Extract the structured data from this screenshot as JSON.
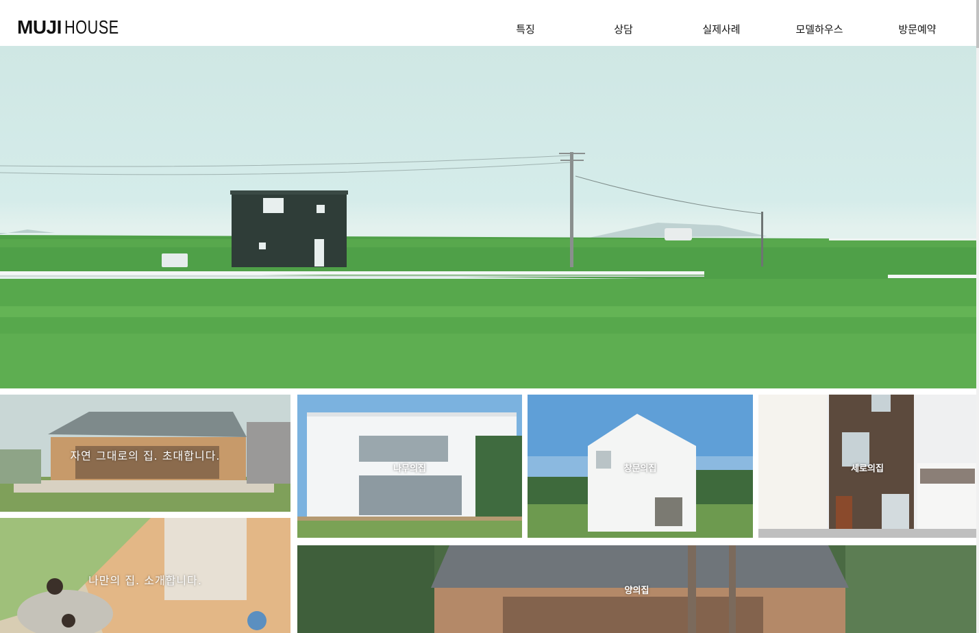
{
  "brand": {
    "logo_bold": "MUJI",
    "logo_thin": "HOUSE"
  },
  "nav": {
    "items": [
      {
        "label": "특징"
      },
      {
        "label": "상담"
      },
      {
        "label": "실제사례"
      },
      {
        "label": "모델하우스"
      },
      {
        "label": "방문예약"
      }
    ]
  },
  "tiles": {
    "invite": {
      "label": "자연 그대로의 집. 초대합니다."
    },
    "wood": {
      "label": "나무의집"
    },
    "window": {
      "label": "창문의집"
    },
    "vertical": {
      "label": "세로의집"
    },
    "mine": {
      "label": "나만의 집. 소개합니다."
    },
    "yang": {
      "label": "양의집"
    }
  },
  "colors": {
    "accent": "#111111",
    "grass": "#56a648",
    "sky": "#d3ebe8"
  }
}
